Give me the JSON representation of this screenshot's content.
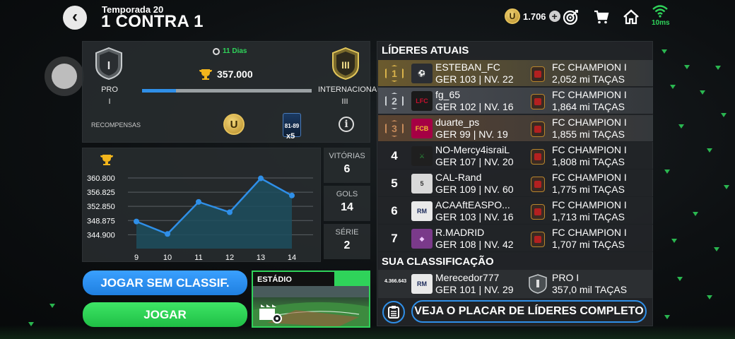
{
  "header": {
    "season": "Temporada 20",
    "title": "1 CONTRA 1",
    "coins": "1.706",
    "wifi_label": "10ms"
  },
  "progress": {
    "timer": "11 Dias",
    "current_rank": "PRO",
    "current_rank_level": "I",
    "current_rank_numeral": "I",
    "next_rank": "INTERNACIONAL",
    "next_rank_level": "III",
    "next_rank_numeral": "III",
    "trophies": "357.000",
    "progress_fraction": 0.2,
    "rewards_label": "RECOMPENSAS",
    "reward_coin_glyph": "U",
    "reward_pack_range": "81-89",
    "reward_pack_mult": "x5"
  },
  "chart_data": {
    "type": "area",
    "x": [
      "9",
      "10",
      "11",
      "12",
      "13",
      "14"
    ],
    "values": [
      348600,
      345100,
      354100,
      351200,
      360700,
      355900
    ],
    "y_ticks": [
      "360.800",
      "356.825",
      "352.850",
      "348.875",
      "344.900"
    ],
    "ylim": [
      341000,
      362000
    ],
    "grid": true,
    "colors": {
      "line": "#2f8fe8",
      "fill": "#1d4e5e"
    }
  },
  "stats": [
    {
      "label": "VITÓRIAS",
      "value": "6"
    },
    {
      "label": "GOLS",
      "value": "14"
    },
    {
      "label": "SÉRIE",
      "value": "2"
    }
  ],
  "buttons": {
    "unranked": "JOGAR SEM CLASSIF.",
    "play": "JOGAR",
    "stadium_label": "ESTÁDIO"
  },
  "leaders": {
    "title": "LÍDERES ATUAIS",
    "rows": [
      {
        "rank": "1",
        "name": "ESTEBAN_FC",
        "stats": "GER 103 | NV. 22",
        "division": "FC CHAMPION I",
        "trophies": "2,052 mi TAÇAS",
        "highlight": "#6b5a2e"
      },
      {
        "rank": "2",
        "name": "fg_65",
        "stats": "GER 102 | NV. 16",
        "division": "FC CHAMPION I",
        "trophies": "1,864 mi TAÇAS",
        "highlight": "#4a4e55"
      },
      {
        "rank": "3",
        "name": "duarte_ps",
        "stats": "GER 99 | NV. 19",
        "division": "FC CHAMPION I",
        "trophies": "1,855 mi TAÇAS",
        "highlight": "#5a4330"
      },
      {
        "rank": "4",
        "name": "NO-Mercy4israiL",
        "stats": "GER 107 | NV. 20",
        "division": "FC CHAMPION I",
        "trophies": "1,808 mi TAÇAS",
        "highlight": ""
      },
      {
        "rank": "5",
        "name": "CAL-Rand",
        "stats": "GER 109 | NV. 60",
        "division": "FC CHAMPION I",
        "trophies": "1,775 mi TAÇAS",
        "highlight": ""
      },
      {
        "rank": "6",
        "name": "ACAAftEASPO...",
        "stats": "GER 103 | NV. 16",
        "division": "FC CHAMPION I",
        "trophies": "1,713 mi TAÇAS",
        "highlight": ""
      },
      {
        "rank": "7",
        "name": "R.MADRID",
        "stats": "GER 108 | NV. 42",
        "division": "FC CHAMPION I",
        "trophies": "1,707 mi TAÇAS",
        "highlight": ""
      }
    ],
    "your_title": "SUA CLASSIFICAÇÃO",
    "your": {
      "rank": "4.366.643",
      "name": "Merecedor777",
      "stats": "GER 101 | NV. 29",
      "division": "PRO I",
      "trophies": "357,0 mil TAÇAS"
    },
    "full_button": "VEJA O PLACAR DE LÍDERES COMPLETO"
  }
}
